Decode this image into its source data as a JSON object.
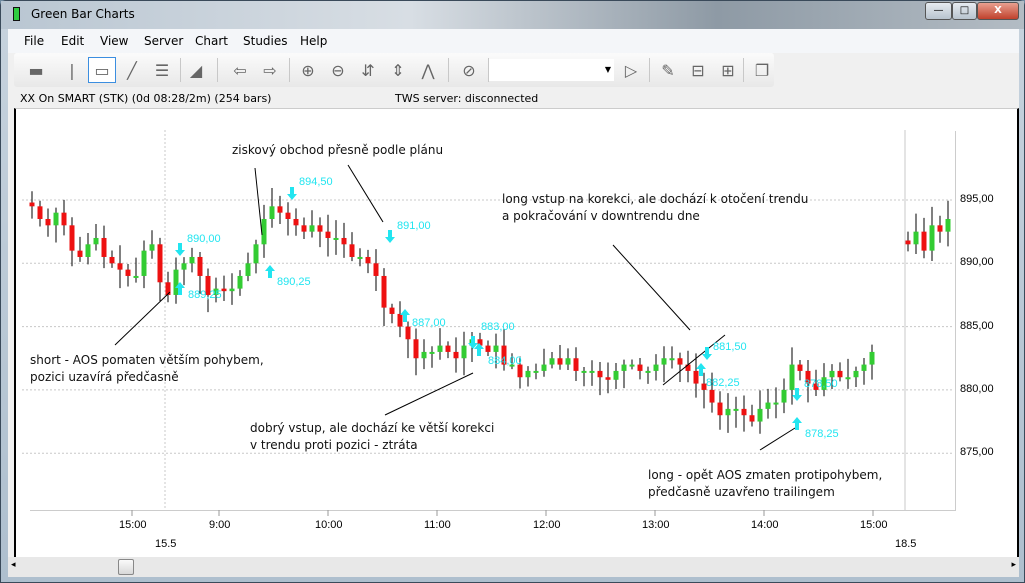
{
  "window": {
    "title": "Green Bar Charts",
    "minimize": "—",
    "maximize": "□",
    "close": "X"
  },
  "menu": [
    "File",
    "Edit",
    "View",
    "Server",
    "Chart",
    "Studies",
    "Help"
  ],
  "toolbar": {
    "icons": [
      "horizontal-line",
      "vertical-line",
      "ray-line",
      "trend-line",
      "fibonacci-lines",
      "eraser",
      "scroll-left",
      "scroll-right",
      "zoom-in",
      "zoom-out",
      "compress-vertical",
      "expand-vertical",
      "auto-scale",
      "stop",
      "apply",
      "properties",
      "remove-study",
      "add-study",
      "windows"
    ],
    "combo_value": ""
  },
  "info": {
    "instrument": "XX On SMART (STK) (0d 08:28/2m) (254 bars)",
    "server": "TWS server: disconnected"
  },
  "chart_data": {
    "type": "candlestick",
    "y_ticks": [
      "895,00",
      "890,00",
      "885,00",
      "880,00",
      "875,00"
    ],
    "y_tick_values": [
      895,
      890,
      885,
      880,
      875
    ],
    "x_ticks": [
      "15:00",
      "9:00",
      "10:00",
      "11:00",
      "12:00",
      "13:00",
      "14:00",
      "15:00"
    ],
    "date_labels": [
      "15.5",
      "18.5"
    ],
    "closes_session1": [
      894.5,
      893.5,
      893,
      894,
      893,
      891,
      890.5,
      891.5,
      892,
      890.5,
      890,
      889.5,
      889,
      889,
      891,
      891.5,
      888.5,
      887.5,
      889.5,
      890,
      890.5,
      889,
      887.5,
      888,
      887.8,
      888,
      889,
      890,
      891.5,
      893.5,
      894.5,
      894,
      893.5,
      893,
      892.5,
      893,
      892.5,
      892,
      892,
      891.5,
      890.5,
      890.5,
      890,
      889,
      886.5,
      886,
      885,
      884,
      882.5,
      883,
      883,
      883.5,
      883,
      882.5,
      883.5,
      884,
      883.5,
      883,
      883.5,
      882,
      882,
      881,
      881.5,
      881.5,
      882,
      882.5,
      882,
      882.5,
      881.5,
      881.5,
      881.5,
      881,
      880.8,
      881.5,
      882,
      882,
      881.5,
      881.5,
      882,
      882.5,
      882.5,
      882,
      881.5,
      880.5,
      880,
      879,
      878,
      878.5,
      878.5,
      878,
      877.5,
      878.5,
      879,
      879,
      880,
      882,
      881.5,
      880.5,
      880,
      881,
      881.5,
      881,
      881,
      881.5,
      882,
      883
    ],
    "closes_session2": [
      891.5,
      892.5,
      891,
      893,
      892.5,
      893.5
    ],
    "signals": [
      {
        "dir": "down",
        "price": "890,00"
      },
      {
        "dir": "up",
        "price": "889,25"
      },
      {
        "dir": "down",
        "price": "894,50"
      },
      {
        "dir": "up",
        "price": "890,25"
      },
      {
        "dir": "down",
        "price": "891,00"
      },
      {
        "dir": "up",
        "price": "887,00"
      },
      {
        "dir": "up",
        "price": "883,00"
      },
      {
        "dir": "down",
        "price": "884,00"
      },
      {
        "dir": "down",
        "price": "881,50"
      },
      {
        "dir": "up",
        "price": "882,25"
      },
      {
        "dir": "down",
        "price": "878,50"
      },
      {
        "dir": "up",
        "price": "878,25"
      }
    ],
    "colors": {
      "up": "#33cc33",
      "down": "#ee1111",
      "signal": "#22e5f0",
      "grid": "#c8c8c8"
    }
  },
  "annotations": {
    "a1": "ziskový obchod přesně podle plánu",
    "a2l1": "long vstup na korekci, ale dochází k otočení trendu",
    "a2l2": "a pokračování v downtrendu dne",
    "a3l1": "short - AOS pomaten větším pohybem,",
    "a3l2": "pozici uzavírá předčasně",
    "a4l1": "dobrý vstup, ale dochází ke větší korekci",
    "a4l2": "v trendu proti pozici - ztráta",
    "a5l1": "long - opět AOS zmaten protipohybem,",
    "a5l2": "předčasně uzavřeno trailingem"
  }
}
